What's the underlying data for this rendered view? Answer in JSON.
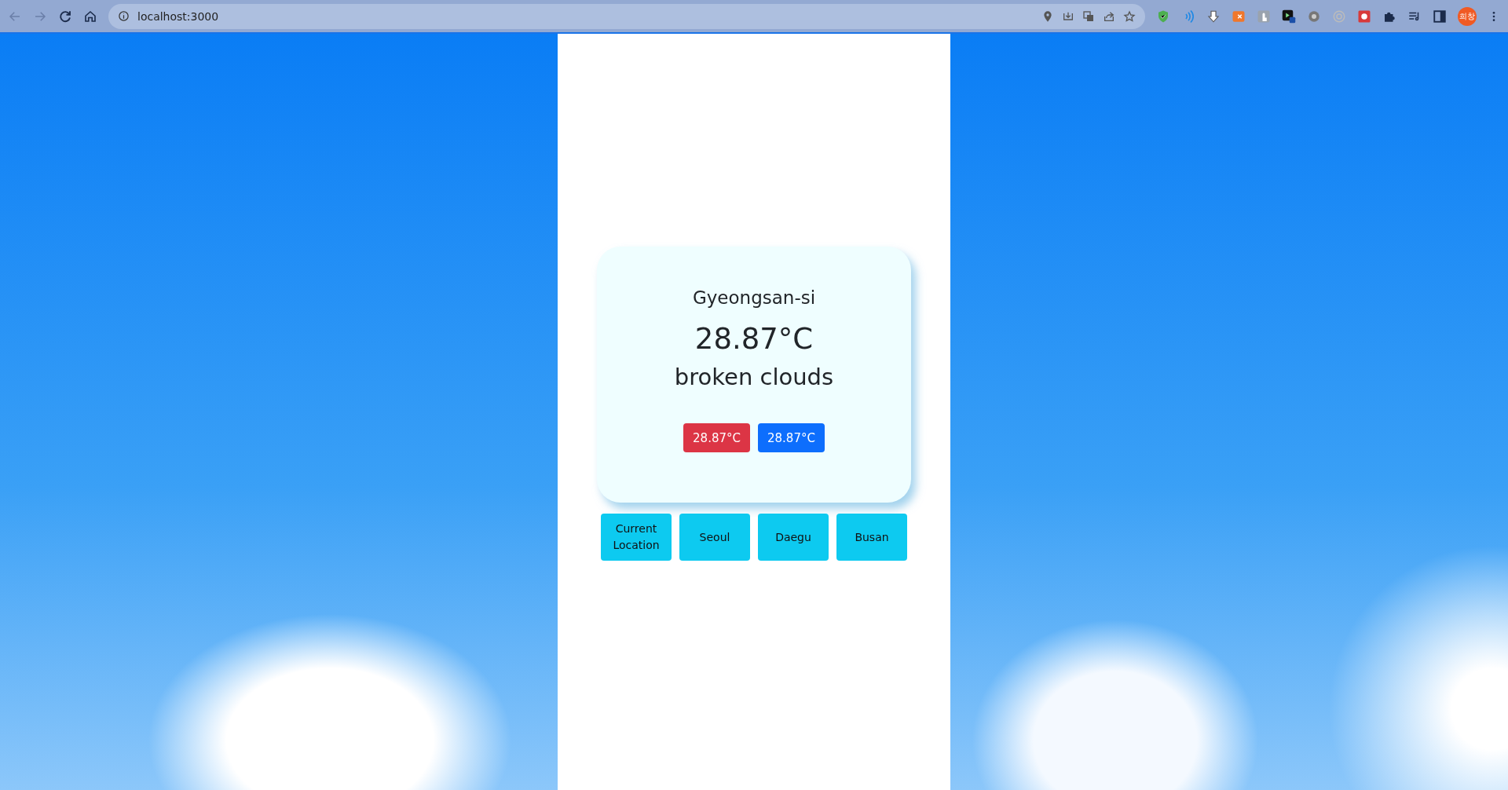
{
  "browser": {
    "url": "localhost:3000",
    "profile_initials": "희창"
  },
  "weather_card": {
    "city": "Gyeongsan-si",
    "temperature": "28.87°C",
    "description": "broken clouds",
    "badges": [
      {
        "kind": "max",
        "text": "28.87°C"
      },
      {
        "kind": "min",
        "text": "28.87°C"
      }
    ]
  },
  "city_buttons": [
    {
      "label": "Current Location"
    },
    {
      "label": "Seoul"
    },
    {
      "label": "Daegu"
    },
    {
      "label": "Busan"
    }
  ]
}
